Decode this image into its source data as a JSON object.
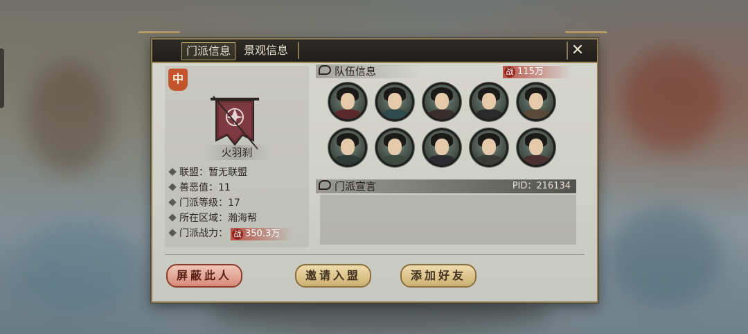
{
  "tabs": [
    {
      "label": "门派信息",
      "active": true
    },
    {
      "label": "景观信息",
      "active": false
    }
  ],
  "close_icon": "close-icon",
  "sect": {
    "rank_badge": "中",
    "name": "火羽刹",
    "info": [
      {
        "label": "联盟：",
        "value": "暂无联盟"
      },
      {
        "label": "善恶值：",
        "value": "11"
      },
      {
        "label": "门派等级：",
        "value": "17"
      },
      {
        "label": "所在区域：",
        "value": "瀚海帮"
      },
      {
        "label": "门派战力：",
        "value": "350.3万"
      }
    ],
    "power_icon_text": "战"
  },
  "team": {
    "title": "队伍信息",
    "power_icon_text": "战",
    "power": "115万",
    "members_count_shown": 10
  },
  "declaration": {
    "title": "门派宣言",
    "pid": "PID：216134",
    "text": ""
  },
  "buttons": {
    "block": "屏蔽此人",
    "invite": "邀请入盟",
    "add_friend": "添加好友"
  },
  "colors": {
    "accent_gold": "#c9ae72",
    "power_red": "#b83f32",
    "badge_orange": "#c3552c",
    "block_button": "#d68c79"
  }
}
